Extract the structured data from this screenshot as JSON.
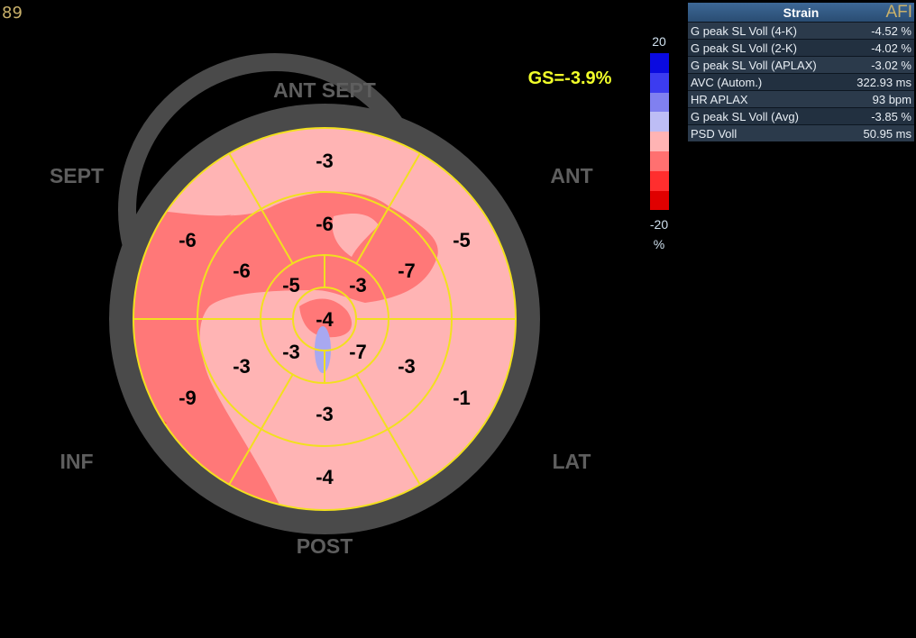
{
  "corner_text": "89",
  "global_strain": "GS=-3.9%",
  "regions": {
    "ant_sept": "ANT  SEPT",
    "sept": "SEPT",
    "ant": "ANT",
    "inf": "INF",
    "lat": "LAT",
    "post": "POST"
  },
  "segments": {
    "basal": [
      "-3",
      "-5",
      "-1",
      "-4",
      "-9",
      "-6"
    ],
    "mid": [
      "-6",
      "-7",
      "-3",
      "-3",
      "-3",
      "-6"
    ],
    "apical": [
      "-3",
      "-7",
      "-3",
      "-5"
    ],
    "apex": "-4"
  },
  "scale": {
    "top": "20",
    "bottom": "-20",
    "unit": "%",
    "colors": [
      "#0a0ae0",
      "#3c3cf0",
      "#8080f0",
      "#bdbdf5",
      "#ffb4b4",
      "#ff7070",
      "#ff2e2e",
      "#e00000"
    ]
  },
  "strain_table": {
    "title": "Strain",
    "badge": "AFI",
    "rows": [
      {
        "label": "G peak SL Voll (4-K)",
        "value": "-4.52 %"
      },
      {
        "label": "G peak SL Voll (2-K)",
        "value": "-4.02 %"
      },
      {
        "label": "G peak SL Voll (APLAX)",
        "value": "-3.02 %"
      },
      {
        "label": "AVC (Autom.)",
        "value": "322.93 ms"
      },
      {
        "label": "HR APLAX",
        "value": "93 bpm"
      },
      {
        "label": "G peak SL Voll (Avg)",
        "value": "-3.85 %"
      },
      {
        "label": "PSD Voll",
        "value": "50.95 ms"
      }
    ]
  }
}
